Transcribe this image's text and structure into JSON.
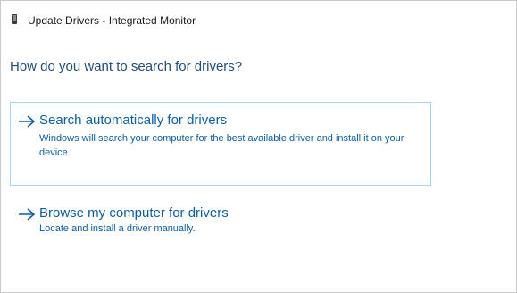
{
  "window": {
    "title": "Update Drivers - Integrated Monitor",
    "icon": "monitor-device-icon"
  },
  "main": {
    "heading": "How do you want to search for drivers?",
    "options": [
      {
        "title": "Search automatically for drivers",
        "description": "Windows will search your computer for the best available driver and install it on your device.",
        "icon": "arrow-right-icon"
      },
      {
        "title": "Browse my computer for drivers",
        "description": "Locate and install a driver manually.",
        "icon": "arrow-right-icon"
      }
    ]
  },
  "colors": {
    "heading": "#1f4e79",
    "link": "#0b5ea8",
    "selected_border": "#a9d4ef"
  }
}
